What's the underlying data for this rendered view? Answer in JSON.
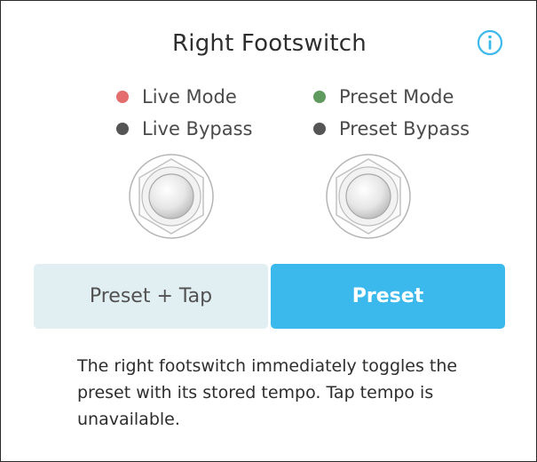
{
  "title": "Right Footswitch",
  "info_icon": "info-circle-icon",
  "legend": {
    "live_mode": {
      "label": "Live Mode",
      "color": "#e46e6e"
    },
    "live_bypass": {
      "label": "Live Bypass",
      "color": "#555555"
    },
    "preset_mode": {
      "label": "Preset Mode",
      "color": "#5f9b5f"
    },
    "preset_bypass": {
      "label": "Preset Bypass",
      "color": "#555555"
    }
  },
  "footswitches": [
    "footswitch-icon",
    "footswitch-icon"
  ],
  "options": {
    "preset_tap": "Preset + Tap",
    "preset": "Preset",
    "selected": "Preset"
  },
  "description": "The right footswitch immediately toggles the preset with its stored tempo. Tap tempo is unavailable.",
  "colors": {
    "accent": "#3bb8ec",
    "unselected_bg": "#e1eef2"
  }
}
